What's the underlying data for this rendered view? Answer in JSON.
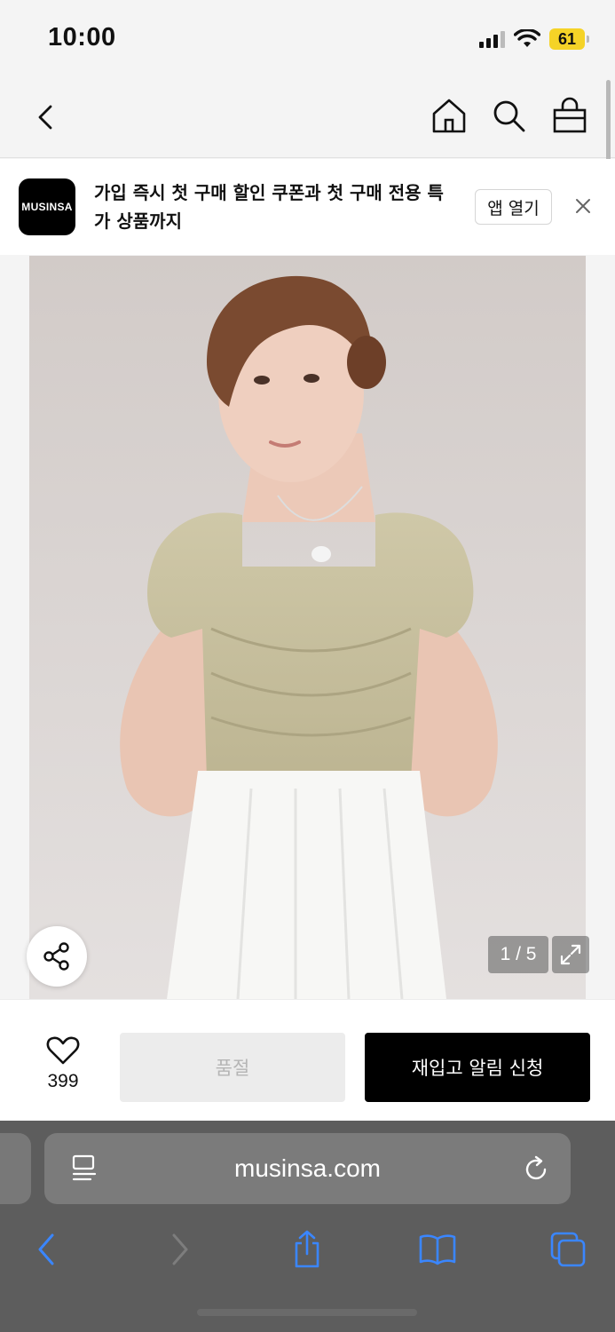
{
  "status_bar": {
    "time": "10:00",
    "battery": "61"
  },
  "nav": {
    "back_label": "back",
    "home_label": "home",
    "search_label": "search",
    "cart_label": "cart"
  },
  "banner": {
    "logo_text": "MUSINSA",
    "message": "가입 즉시 첫 구매 할인 쿠폰과 첫 구매 전용 특가 상품까지",
    "open_app_label": "앱 열기"
  },
  "gallery": {
    "counter": "1 / 5"
  },
  "actions": {
    "like_count": "399",
    "soldout_label": "품절",
    "restock_label": "재입고 알림 신청"
  },
  "browser": {
    "url": "musinsa.com"
  },
  "colors": {
    "accent_battery": "#f5d327",
    "safari_blue": "#3a86ff",
    "primary_button": "#000000"
  }
}
